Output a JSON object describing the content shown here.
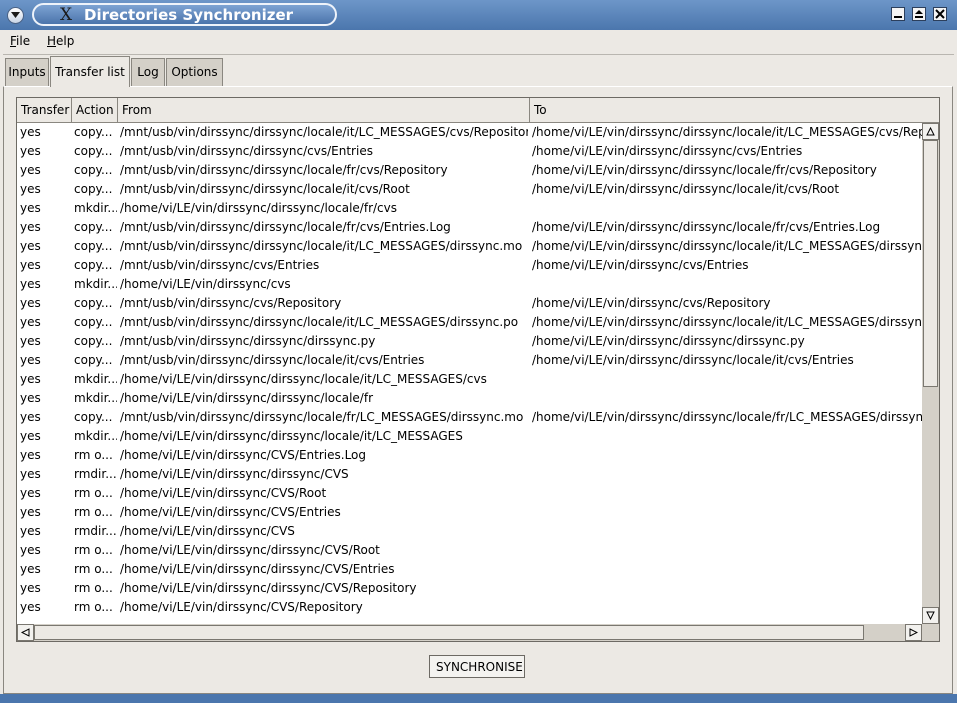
{
  "window": {
    "title": "Directories Synchronizer",
    "icon": "x-logo-icon",
    "title_x_glyph": "X"
  },
  "menu": [
    {
      "label": "File",
      "mnemonic": "F",
      "rest": "ile"
    },
    {
      "label": "Help",
      "mnemonic": "H",
      "rest": "elp"
    }
  ],
  "tabs": [
    {
      "label": "Inputs",
      "active": false
    },
    {
      "label": "Transfer list",
      "active": true
    },
    {
      "label": "Log",
      "active": false
    },
    {
      "label": "Options",
      "active": false
    }
  ],
  "table": {
    "columns": [
      "Transfer",
      "Action",
      "From",
      "To"
    ],
    "rows": [
      [
        "yes",
        "copy...",
        "/mnt/usb/vin/dirssync/dirssync/locale/it/LC_MESSAGES/cvs/Repository",
        "/home/vi/LE/vin/dirssync/dirssync/locale/it/LC_MESSAGES/cvs/Repository"
      ],
      [
        "yes",
        "copy...",
        "/mnt/usb/vin/dirssync/dirssync/cvs/Entries",
        "/home/vi/LE/vin/dirssync/dirssync/cvs/Entries"
      ],
      [
        "yes",
        "copy...",
        "/mnt/usb/vin/dirssync/dirssync/locale/fr/cvs/Repository",
        "/home/vi/LE/vin/dirssync/dirssync/locale/fr/cvs/Repository"
      ],
      [
        "yes",
        "copy...",
        "/mnt/usb/vin/dirssync/dirssync/locale/it/cvs/Root",
        "/home/vi/LE/vin/dirssync/dirssync/locale/it/cvs/Root"
      ],
      [
        "yes",
        "mkdir...",
        "/home/vi/LE/vin/dirssync/dirssync/locale/fr/cvs",
        ""
      ],
      [
        "yes",
        "copy...",
        "/mnt/usb/vin/dirssync/dirssync/locale/fr/cvs/Entries.Log",
        "/home/vi/LE/vin/dirssync/dirssync/locale/fr/cvs/Entries.Log"
      ],
      [
        "yes",
        "copy...",
        "/mnt/usb/vin/dirssync/dirssync/locale/it/LC_MESSAGES/dirssync.mo",
        "/home/vi/LE/vin/dirssync/dirssync/locale/it/LC_MESSAGES/dirssync.mo"
      ],
      [
        "yes",
        "copy...",
        "/mnt/usb/vin/dirssync/cvs/Entries",
        "/home/vi/LE/vin/dirssync/cvs/Entries"
      ],
      [
        "yes",
        "mkdir...",
        "/home/vi/LE/vin/dirssync/cvs",
        ""
      ],
      [
        "yes",
        "copy...",
        "/mnt/usb/vin/dirssync/cvs/Repository",
        "/home/vi/LE/vin/dirssync/cvs/Repository"
      ],
      [
        "yes",
        "copy...",
        "/mnt/usb/vin/dirssync/dirssync/locale/it/LC_MESSAGES/dirssync.po",
        "/home/vi/LE/vin/dirssync/dirssync/locale/it/LC_MESSAGES/dirssync.po"
      ],
      [
        "yes",
        "copy...",
        "/mnt/usb/vin/dirssync/dirssync/dirssync.py",
        "/home/vi/LE/vin/dirssync/dirssync/dirssync.py"
      ],
      [
        "yes",
        "copy...",
        "/mnt/usb/vin/dirssync/dirssync/locale/it/cvs/Entries",
        "/home/vi/LE/vin/dirssync/dirssync/locale/it/cvs/Entries"
      ],
      [
        "yes",
        "mkdir...",
        "/home/vi/LE/vin/dirssync/dirssync/locale/it/LC_MESSAGES/cvs",
        ""
      ],
      [
        "yes",
        "mkdir...",
        "/home/vi/LE/vin/dirssync/dirssync/locale/fr",
        ""
      ],
      [
        "yes",
        "copy...",
        "/mnt/usb/vin/dirssync/dirssync/locale/fr/LC_MESSAGES/dirssync.mo",
        "/home/vi/LE/vin/dirssync/dirssync/locale/fr/LC_MESSAGES/dirssync.mo"
      ],
      [
        "yes",
        "mkdir...",
        "/home/vi/LE/vin/dirssync/dirssync/locale/it/LC_MESSAGES",
        ""
      ],
      [
        "yes",
        "rm o...",
        "/home/vi/LE/vin/dirssync/CVS/Entries.Log",
        ""
      ],
      [
        "yes",
        "rmdir...",
        "/home/vi/LE/vin/dirssync/dirssync/CVS",
        ""
      ],
      [
        "yes",
        "rm o...",
        "/home/vi/LE/vin/dirssync/CVS/Root",
        ""
      ],
      [
        "yes",
        "rm o...",
        "/home/vi/LE/vin/dirssync/CVS/Entries",
        ""
      ],
      [
        "yes",
        "rmdir...",
        "/home/vi/LE/vin/dirssync/CVS",
        ""
      ],
      [
        "yes",
        "rm o...",
        "/home/vi/LE/vin/dirssync/dirssync/CVS/Root",
        ""
      ],
      [
        "yes",
        "rm o...",
        "/home/vi/LE/vin/dirssync/dirssync/CVS/Entries",
        ""
      ],
      [
        "yes",
        "rm o...",
        "/home/vi/LE/vin/dirssync/dirssync/CVS/Repository",
        ""
      ],
      [
        "yes",
        "rm o...",
        "/home/vi/LE/vin/dirssync/CVS/Repository",
        ""
      ]
    ]
  },
  "actions": {
    "synchronise_label": "SYNCHRONISE"
  },
  "colors": {
    "titlebar": "#4b76ad",
    "window_bg": "#ece9e4",
    "table_bg": "#ffffff"
  }
}
